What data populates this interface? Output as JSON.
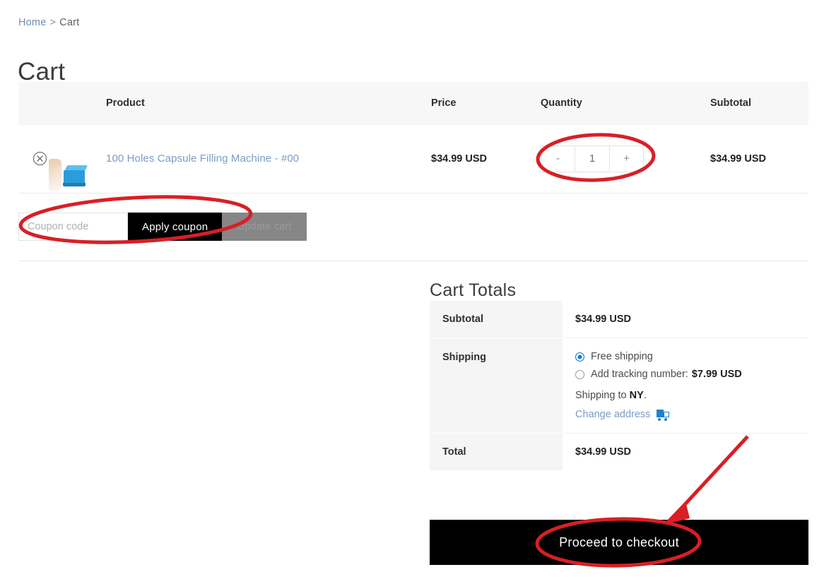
{
  "breadcrumb": {
    "home": "Home",
    "separator": ">",
    "current": "Cart"
  },
  "page_title": "Cart",
  "cart_table": {
    "columns": [
      "",
      "",
      "Product",
      "Price",
      "Quantity",
      "Subtotal"
    ],
    "headers": {
      "product": "Product",
      "price": "Price",
      "quantity": "Quantity",
      "subtotal": "Subtotal"
    },
    "rows": [
      {
        "remove_icon": "circle-x-icon",
        "thumbnail": "capsule-filling-machine-thumbnail",
        "product_name": "100 Holes Capsule Filling Machine - #00",
        "price": "$34.99 USD",
        "quantity": "1",
        "decrement_label": "-",
        "increment_label": "+",
        "subtotal": "$34.99 USD"
      }
    ],
    "coupon": {
      "placeholder": "Coupon code",
      "value": "",
      "apply_label": "Apply coupon"
    },
    "update_cart_label": "Update cart"
  },
  "cart_totals": {
    "heading": "Cart Totals",
    "rows": [
      {
        "label": "Subtotal",
        "value": "$34.99 USD"
      },
      {
        "label": "Shipping",
        "value": ""
      },
      {
        "label": "Total",
        "value": "$34.99 USD"
      }
    ],
    "subtotal_label": "Subtotal",
    "subtotal_value": "$34.99 USD",
    "shipping_label": "Shipping",
    "shipping_options": [
      {
        "label": "Free shipping",
        "price": "",
        "selected": true
      },
      {
        "label": "Add tracking number:",
        "price": "$7.99 USD",
        "selected": false
      }
    ],
    "shipping_to_prefix": "Shipping to",
    "shipping_to_state": "NY",
    "shipping_to_suffix": ".",
    "change_address_label": "Change address",
    "change_address_icon": "truck-icon",
    "total_label": "Total",
    "total_value": "$34.99 USD"
  },
  "checkout_button_label": "Proceed to checkout",
  "annotations": {
    "accent_color": "#d81f26",
    "highlights": [
      {
        "name": "quantity-stepper-highlight",
        "shape": "ellipse"
      },
      {
        "name": "coupon-area-highlight",
        "shape": "ellipse"
      },
      {
        "name": "proceed-to-checkout-highlight",
        "shape": "ellipse"
      },
      {
        "name": "proceed-to-checkout-arrow",
        "shape": "arrow"
      }
    ]
  },
  "colors": {
    "link": "#7a9cc6",
    "button_primary": "#000000",
    "button_disabled": "#868686",
    "radio_selected": "#1077d6",
    "header_bg": "#f7f7f7",
    "totals_label_bg": "#f5f5f5",
    "annotation_red": "#d81f26"
  }
}
